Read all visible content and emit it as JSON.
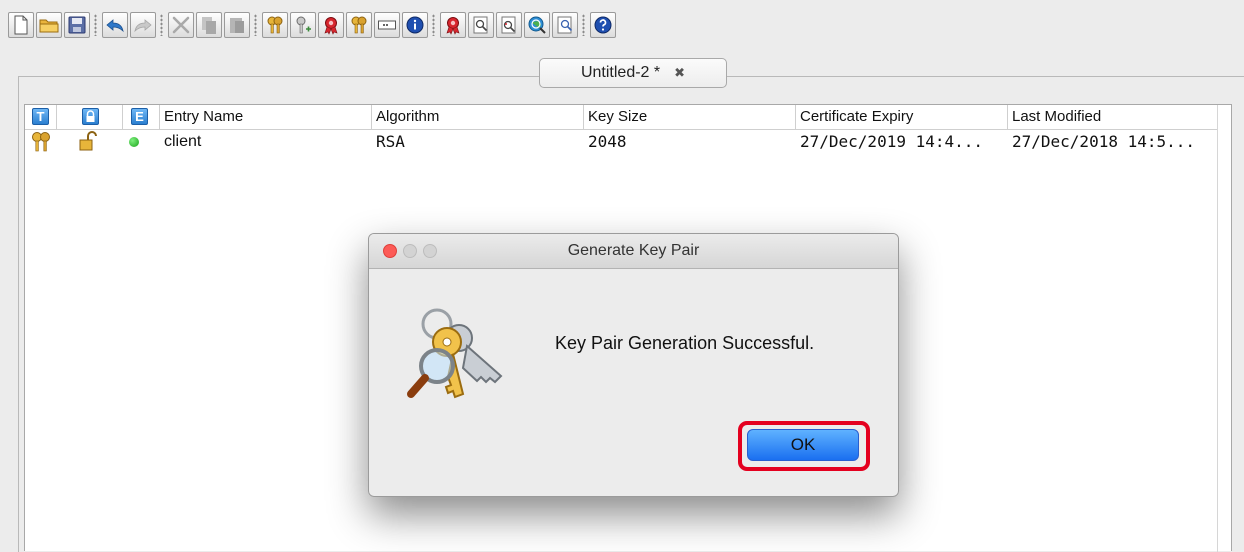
{
  "toolbar": {
    "buttons": [
      {
        "name": "new-keystore",
        "icon": "new-document-icon"
      },
      {
        "name": "open-keystore",
        "icon": "folder-open-icon"
      },
      {
        "name": "save-keystore",
        "icon": "floppy-disk-icon"
      },
      {
        "name": "undo",
        "icon": "undo-arrow-icon"
      },
      {
        "name": "redo",
        "icon": "redo-arrow-icon"
      },
      {
        "name": "cut",
        "icon": "scissors-icon"
      },
      {
        "name": "copy",
        "icon": "copy-icon"
      },
      {
        "name": "paste",
        "icon": "paste-icon"
      },
      {
        "name": "generate-key-pair",
        "icon": "key-pair-icon"
      },
      {
        "name": "generate-secret-key",
        "icon": "key-plus-icon"
      },
      {
        "name": "import-trusted-certificate",
        "icon": "certificate-ribbon-icon"
      },
      {
        "name": "import-key-pair",
        "icon": "key-pair-import-icon"
      },
      {
        "name": "set-password",
        "icon": "password-field-icon"
      },
      {
        "name": "properties",
        "icon": "info-icon"
      },
      {
        "name": "examine-certificate",
        "icon": "certificate-examine-icon"
      },
      {
        "name": "examine-csr",
        "icon": "magnifier-document-icon"
      },
      {
        "name": "examine-crl",
        "icon": "magnifier-list-icon"
      },
      {
        "name": "examine-ssl",
        "icon": "globe-magnifier-icon"
      },
      {
        "name": "examine-clipboard",
        "icon": "clipboard-magnifier-icon"
      },
      {
        "name": "help",
        "icon": "help-icon"
      }
    ]
  },
  "tab": {
    "label": "Untitled-2 *",
    "close_glyph": "✖"
  },
  "table": {
    "icon_headers": [
      "T",
      "🔒",
      "E"
    ],
    "columns": [
      "Entry Name",
      "Algorithm",
      "Key Size",
      "Certificate Expiry",
      "Last Modified"
    ],
    "rows": [
      {
        "type_icon": "key-pair-icon",
        "lock_icon": "unlocked-padlock-icon",
        "status_icon": "green-dot-icon",
        "entry_name": "client",
        "algorithm": "RSA",
        "key_size": "2048",
        "certificate_expiry": "27/Dec/2019 14:4...",
        "last_modified": "27/Dec/2018 14:5..."
      }
    ]
  },
  "dialog": {
    "title": "Generate Key Pair",
    "message": "Key Pair Generation Successful.",
    "ok_label": "OK",
    "icon": "keys-magnifier-icon"
  },
  "colors": {
    "close_red": "#fc5b57",
    "disabled_gray": "#d3d3d3",
    "ok_blue": "#1a6ff0",
    "highlight_red": "#e4001f"
  }
}
